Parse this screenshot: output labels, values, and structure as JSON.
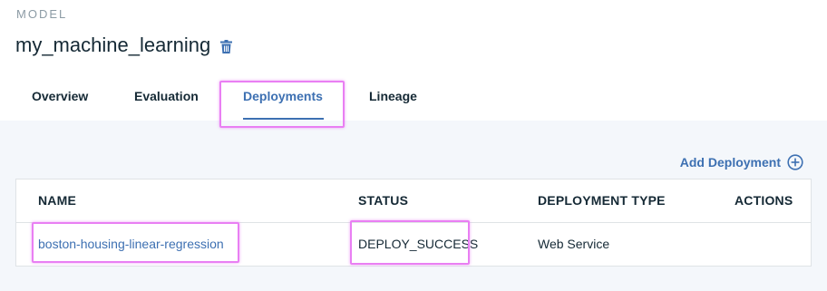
{
  "header": {
    "kicker": "MODEL",
    "title": "my_machine_learning",
    "title_action_icon": "trash-icon"
  },
  "tabs": [
    {
      "label": "Overview",
      "active": false
    },
    {
      "label": "Evaluation",
      "active": false
    },
    {
      "label": "Deployments",
      "active": true
    },
    {
      "label": "Lineage",
      "active": false
    }
  ],
  "toolbar": {
    "add_label": "Add Deployment",
    "add_icon": "add-circle-icon"
  },
  "table": {
    "columns": [
      "NAME",
      "STATUS",
      "DEPLOYMENT TYPE",
      "ACTIONS"
    ],
    "rows": [
      {
        "name": "boston-housing-linear-regression",
        "status": "DEPLOY_SUCCESS",
        "type": "Web Service",
        "actions": ""
      }
    ]
  },
  "colors": {
    "accent": "#3d70b2",
    "text": "#152935",
    "muted": "#8c9ba5",
    "content_bg": "#f4f7fb",
    "highlight": "#e97ff3"
  }
}
